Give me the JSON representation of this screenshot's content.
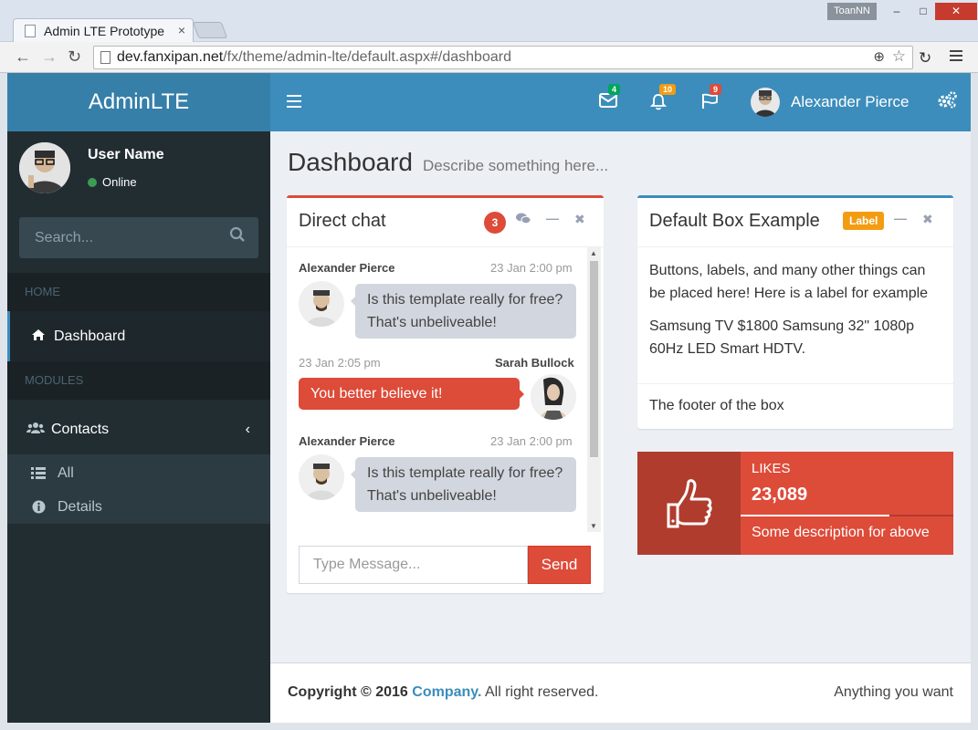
{
  "browser": {
    "tab_title": "Admin LTE Prototype",
    "tab_close": "×",
    "os_user": "ToanNN",
    "url_host": "dev.fanxipan.net",
    "url_path": "/fx/theme/admin-lte/default.aspx#/dashboard"
  },
  "app": {
    "logo": "AdminLTE",
    "nav": {
      "mail_count": "4",
      "notifications_count": "10",
      "flags_count": "9",
      "user_name": "Alexander Pierce",
      "colors": {
        "mail": "#00a65a",
        "notifications": "#f39c12",
        "flags": "#dd4b39"
      }
    }
  },
  "sidebar": {
    "user_name": "User Name",
    "status": "Online",
    "search_placeholder": "Search...",
    "header_home": "HOME",
    "item_dashboard": "Dashboard",
    "header_modules": "MODULES",
    "item_contacts": "Contacts",
    "sub_all": "All",
    "sub_details": "Details"
  },
  "content": {
    "title": "Dashboard",
    "subtitle": "Describe something here..."
  },
  "chat": {
    "title": "Direct chat",
    "badge": "3",
    "messages": [
      {
        "name": "Alexander Pierce",
        "time": "23 Jan 2:00 pm",
        "text": "Is this template really for free? That's unbeliveable!",
        "side": "left"
      },
      {
        "name": "Sarah Bullock",
        "time": "23 Jan 2:05 pm",
        "text": "You better believe it!",
        "side": "right"
      },
      {
        "name": "Alexander Pierce",
        "time": "23 Jan 2:00 pm",
        "text": "Is this template really for free? That's unbeliveable!",
        "side": "left"
      }
    ],
    "input_placeholder": "Type Message...",
    "send_label": "Send"
  },
  "default_box": {
    "title": "Default Box Example",
    "label": "Label",
    "body_1": "Buttons, labels, and many other things can be placed here! Here is a label for example",
    "body_2": "Samsung TV $1800 Samsung 32\" 1080p 60Hz LED Smart HDTV.",
    "footer": "The footer of the box"
  },
  "likes": {
    "label": "LIKES",
    "value": "23,089",
    "progress": 0.7,
    "description": "Some description for above"
  },
  "footer": {
    "copyright": "Copyright © 2016",
    "company": "Company.",
    "rights": "All right reserved.",
    "right_text": "Anything you want"
  }
}
